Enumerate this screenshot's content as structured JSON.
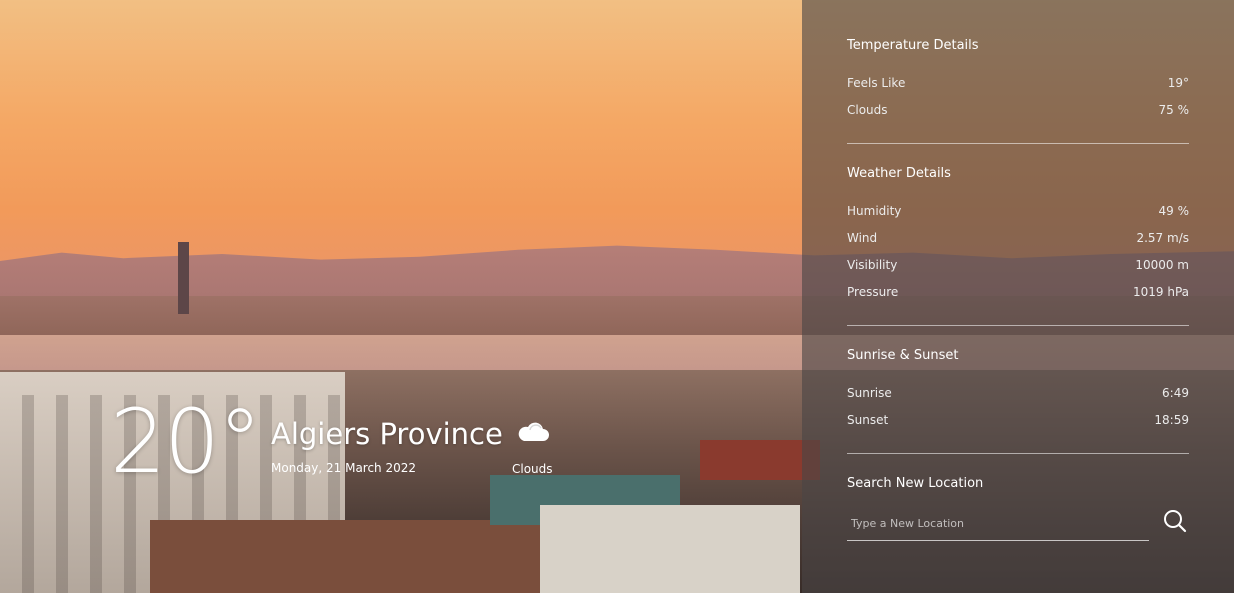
{
  "current": {
    "temperature": "20°",
    "location": "Algiers Province",
    "date": "Monday, 21 March 2022",
    "condition": "Clouds",
    "condition_icon": "cloud-icon"
  },
  "panel": {
    "temperature_details": {
      "title": "Temperature Details",
      "rows": [
        {
          "label": "Feels Like",
          "value": "19°"
        },
        {
          "label": "Clouds",
          "value": "75 %"
        }
      ]
    },
    "weather_details": {
      "title": "Weather Details",
      "rows": [
        {
          "label": "Humidity",
          "value": "49 %"
        },
        {
          "label": "Wind",
          "value": "2.57 m/s"
        },
        {
          "label": "Visibility",
          "value": "10000 m"
        },
        {
          "label": "Pressure",
          "value": "1019 hPa"
        }
      ]
    },
    "sunrise_sunset": {
      "title": "Sunrise & Sunset",
      "rows": [
        {
          "label": "Sunrise",
          "value": "6:49"
        },
        {
          "label": "Sunset",
          "value": "18:59"
        }
      ]
    },
    "search": {
      "title": "Search New Location",
      "placeholder": "Type a New Location",
      "value": "",
      "button_icon": "search-icon"
    }
  },
  "colors": {
    "panel_overlay": "#4b4646",
    "text": "#ffffff",
    "sky_top": "#f2bf83",
    "sky_bottom": "#e9946a"
  }
}
